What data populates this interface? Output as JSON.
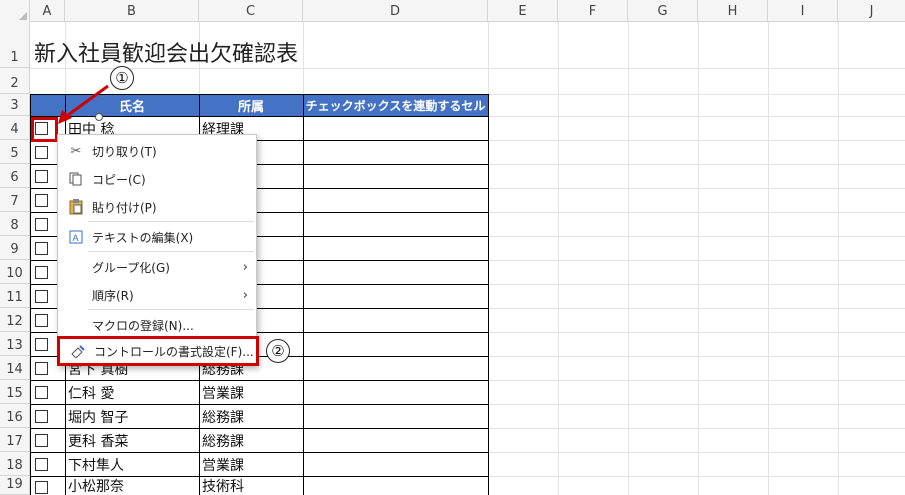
{
  "spreadsheet": {
    "corner_label": "",
    "columns": [
      "A",
      "B",
      "C",
      "D",
      "E",
      "F",
      "G",
      "H",
      "I",
      "J"
    ],
    "rows": [
      "1",
      "2",
      "3",
      "4",
      "5",
      "6",
      "7",
      "8",
      "9",
      "10",
      "11",
      "12",
      "13",
      "14",
      "15",
      "16",
      "17",
      "18",
      "19"
    ],
    "title": "新入社員歓迎会出欠確認表",
    "table_headers": {
      "name": "氏名",
      "dept": "所属",
      "linked": "チェックボックスを連動するセル"
    },
    "table_rows": [
      {
        "name": "田中 稔",
        "dept": "経理課"
      },
      {
        "name": "宮下 真樹",
        "dept": "総務課"
      },
      {
        "name": "仁科 愛",
        "dept": "営業課"
      },
      {
        "name": "堀内 智子",
        "dept": "総務課"
      },
      {
        "name": "更科 香菜",
        "dept": "総務課"
      },
      {
        "name": "下村隼人",
        "dept": "営業課"
      },
      {
        "name": "小松那奈",
        "dept": "技術科"
      }
    ]
  },
  "annotations": {
    "step1": "①",
    "step2": "②"
  },
  "context_menu": {
    "items": [
      {
        "icon": "scissors-icon",
        "label": "切り取り(T)"
      },
      {
        "icon": "copy-icon",
        "label": "コピー(C)"
      },
      {
        "icon": "paste-icon",
        "label": "貼り付け(P)"
      },
      {
        "icon": "edit-text-icon",
        "label": "テキストの編集(X)"
      },
      {
        "icon": "",
        "label": "グループ化(G)"
      },
      {
        "icon": "",
        "label": "順序(R)"
      },
      {
        "icon": "",
        "label": "マクロの登録(N)..."
      },
      {
        "icon": "format-control-icon",
        "label": "コントロールの書式設定(F)..."
      }
    ],
    "submenu_arrow": "›"
  },
  "colors": {
    "header_fill": "#4472c4",
    "highlight": "#d00000"
  }
}
